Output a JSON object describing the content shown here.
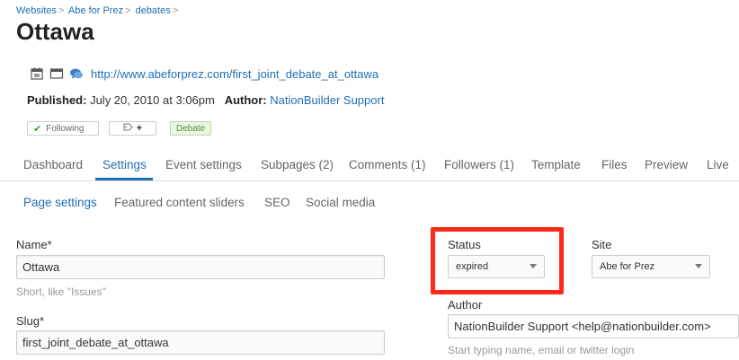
{
  "breadcrumb": {
    "items": [
      "Websites",
      "Abe for Prez",
      "debates"
    ],
    "separator": ">"
  },
  "page": {
    "title": "Ottawa"
  },
  "meta": {
    "url": "http://www.abeforprez.com/first_joint_debate_at_ottawa",
    "icons": [
      "calendar-icon",
      "window-icon",
      "comments-icon"
    ]
  },
  "published": {
    "label": "Published:",
    "value": "July 20, 2010 at 3:06pm",
    "author_label": "Author:",
    "author": "NationBuilder Support"
  },
  "tags": {
    "following_label": "Following",
    "tag_symbol": "+",
    "debate": "Debate"
  },
  "tabs": [
    {
      "label": "Dashboard",
      "active": false
    },
    {
      "label": "Settings",
      "active": true
    },
    {
      "label": "Event settings",
      "active": false
    },
    {
      "label": "Subpages (2)",
      "active": false
    },
    {
      "label": "Comments (1)",
      "active": false
    },
    {
      "label": "Followers (1)",
      "active": false
    },
    {
      "label": "Template",
      "active": false
    },
    {
      "label": "Files",
      "active": false
    },
    {
      "label": "Preview",
      "active": false
    },
    {
      "label": "Live",
      "active": false
    }
  ],
  "subtabs": [
    {
      "label": "Page settings",
      "active": true
    },
    {
      "label": "Featured content sliders",
      "active": false
    },
    {
      "label": "SEO",
      "active": false
    },
    {
      "label": "Social media",
      "active": false
    }
  ],
  "form": {
    "name_label": "Name*",
    "name_value": "Ottawa",
    "name_hint": "Short, like \"Issues\"",
    "slug_label": "Slug*",
    "slug_value": "first_joint_debate_at_ottawa",
    "status_label": "Status",
    "status_value": "expired",
    "site_label": "Site",
    "site_value": "Abe for Prez",
    "author_label": "Author",
    "author_value": "NationBuilder Support <help@nationbuilder.com>",
    "author_hint": "Start typing name, email or twitter login"
  },
  "colors": {
    "link": "#1f6fb2",
    "highlight": "#ff2a1a",
    "debate_tag_bg": "#eaf5e4"
  }
}
